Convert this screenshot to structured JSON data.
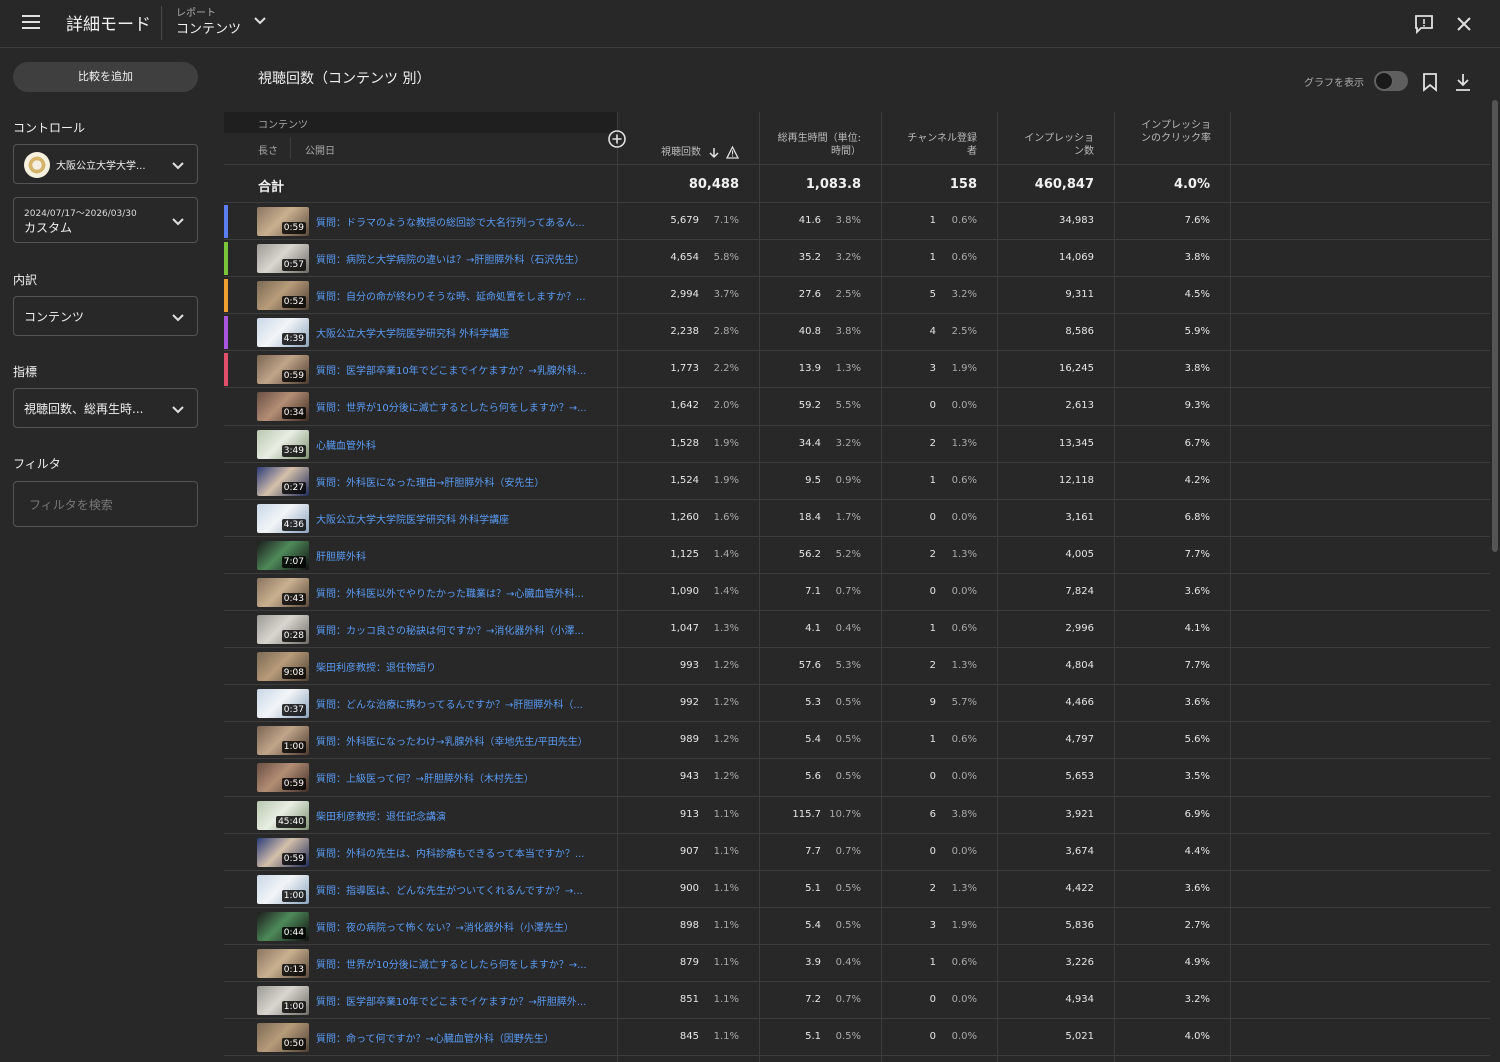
{
  "header": {
    "app_title": "詳細モード",
    "report_label": "レポート",
    "report_value": "コンテンツ"
  },
  "sidebar": {
    "compare_button": "比較を追加",
    "control_label": "コントロール",
    "channel_name": "大阪公立大学大学...",
    "date_range": "2024/07/17〜2026/03/30",
    "date_preset": "カスタム",
    "breakdown_label": "内訳",
    "breakdown_value": "コンテンツ",
    "metrics_label": "指標",
    "metrics_value": "視聴回数、総再生時...",
    "filter_label": "フィルタ",
    "filter_placeholder": "フィルタを検索"
  },
  "main": {
    "title": "視聴回数（コンテンツ 別）",
    "graph_toggle_label": "グラフを表示",
    "graph_toggle_on": false
  },
  "table": {
    "col_content": "コンテンツ",
    "col_length": "長さ",
    "col_published": "公開日",
    "col_views": "視聴回数",
    "col_watch_time": "総再生時間（単位: 時間）",
    "col_subscribers": "チャンネル登録者",
    "col_impressions": "インプレッション数",
    "col_ctr": "インプレッションのクリック率",
    "total_label": "合計",
    "totals": {
      "views": "80,488",
      "watch_time": "1,083.8",
      "subscribers": "158",
      "impressions": "460,847",
      "ctr": "4.0%"
    },
    "rows": [
      {
        "color": "#5b7ef0",
        "duration": "0:59",
        "title": "質問：ドラマのような教授の総回診で大名行列ってあるん...",
        "views": "5,679",
        "views_pct": "7.1%",
        "watch": "41.6",
        "watch_pct": "3.8%",
        "subs": "1",
        "subs_pct": "0.6%",
        "impr": "34,983",
        "ctr": "7.6%"
      },
      {
        "color": "#7cc43a",
        "duration": "0:57",
        "title": "質問：病院と大学病院の違いは？→肝胆膵外科（石沢先生）",
        "views": "4,654",
        "views_pct": "5.8%",
        "watch": "35.2",
        "watch_pct": "3.2%",
        "subs": "1",
        "subs_pct": "0.6%",
        "impr": "14,069",
        "ctr": "3.8%"
      },
      {
        "color": "#f0a030",
        "duration": "0:52",
        "title": "質問：自分の命が終わりそうな時、延命処置をしますか？...",
        "views": "2,994",
        "views_pct": "3.7%",
        "watch": "27.6",
        "watch_pct": "2.5%",
        "subs": "5",
        "subs_pct": "3.2%",
        "impr": "9,311",
        "ctr": "4.5%"
      },
      {
        "color": "#a855e0",
        "duration": "4:39",
        "title": "大阪公立大学大学院医学研究科 外科学講座",
        "views": "2,238",
        "views_pct": "2.8%",
        "watch": "40.8",
        "watch_pct": "3.8%",
        "subs": "4",
        "subs_pct": "2.5%",
        "impr": "8,586",
        "ctr": "5.9%"
      },
      {
        "color": "#e0506a",
        "duration": "0:59",
        "title": "質問：医学部卒業10年でどこまでイケますか？→乳腺外科...",
        "views": "1,773",
        "views_pct": "2.2%",
        "watch": "13.9",
        "watch_pct": "1.3%",
        "subs": "3",
        "subs_pct": "1.9%",
        "impr": "16,245",
        "ctr": "3.8%"
      },
      {
        "color": "",
        "duration": "0:34",
        "title": "質問：世界が10分後に滅亡するとしたら何をしますか？→...",
        "views": "1,642",
        "views_pct": "2.0%",
        "watch": "59.2",
        "watch_pct": "5.5%",
        "subs": "0",
        "subs_pct": "0.0%",
        "impr": "2,613",
        "ctr": "9.3%"
      },
      {
        "color": "",
        "duration": "3:49",
        "title": "心臓血管外科",
        "views": "1,528",
        "views_pct": "1.9%",
        "watch": "34.4",
        "watch_pct": "3.2%",
        "subs": "2",
        "subs_pct": "1.3%",
        "impr": "13,345",
        "ctr": "6.7%"
      },
      {
        "color": "",
        "duration": "0:27",
        "title": "質問：外科医になった理由→肝胆膵外科（安先生）",
        "views": "1,524",
        "views_pct": "1.9%",
        "watch": "9.5",
        "watch_pct": "0.9%",
        "subs": "1",
        "subs_pct": "0.6%",
        "impr": "12,118",
        "ctr": "4.2%"
      },
      {
        "color": "",
        "duration": "4:36",
        "title": "大阪公立大学大学院医学研究科 外科学講座",
        "views": "1,260",
        "views_pct": "1.6%",
        "watch": "18.4",
        "watch_pct": "1.7%",
        "subs": "0",
        "subs_pct": "0.0%",
        "impr": "3,161",
        "ctr": "6.8%"
      },
      {
        "color": "",
        "duration": "7:07",
        "title": "肝胆膵外科",
        "views": "1,125",
        "views_pct": "1.4%",
        "watch": "56.2",
        "watch_pct": "5.2%",
        "subs": "2",
        "subs_pct": "1.3%",
        "impr": "4,005",
        "ctr": "7.7%"
      },
      {
        "color": "",
        "duration": "0:43",
        "title": "質問：外科医以外でやりたかった職業は？→心臓血管外科...",
        "views": "1,090",
        "views_pct": "1.4%",
        "watch": "7.1",
        "watch_pct": "0.7%",
        "subs": "0",
        "subs_pct": "0.0%",
        "impr": "7,824",
        "ctr": "3.6%"
      },
      {
        "color": "",
        "duration": "0:28",
        "title": "質問：カッコ良さの秘訣は何ですか？→消化器外科（小澤...",
        "views": "1,047",
        "views_pct": "1.3%",
        "watch": "4.1",
        "watch_pct": "0.4%",
        "subs": "1",
        "subs_pct": "0.6%",
        "impr": "2,996",
        "ctr": "4.1%"
      },
      {
        "color": "",
        "duration": "9:08",
        "title": "柴田利彦教授：退任物語り",
        "views": "993",
        "views_pct": "1.2%",
        "watch": "57.6",
        "watch_pct": "5.3%",
        "subs": "2",
        "subs_pct": "1.3%",
        "impr": "4,804",
        "ctr": "7.7%"
      },
      {
        "color": "",
        "duration": "0:37",
        "title": "質問：どんな治療に携わってるんですか？→肝胆膵外科（...",
        "views": "992",
        "views_pct": "1.2%",
        "watch": "5.3",
        "watch_pct": "0.5%",
        "subs": "9",
        "subs_pct": "5.7%",
        "impr": "4,466",
        "ctr": "3.6%"
      },
      {
        "color": "",
        "duration": "1:00",
        "title": "質問：外科医になったわけ→乳腺外科（幸地先生/平田先生）",
        "views": "989",
        "views_pct": "1.2%",
        "watch": "5.4",
        "watch_pct": "0.5%",
        "subs": "1",
        "subs_pct": "0.6%",
        "impr": "4,797",
        "ctr": "5.6%"
      },
      {
        "color": "",
        "duration": "0:59",
        "title": "質問：上級医って何？→肝胆膵外科（木村先生）",
        "views": "943",
        "views_pct": "1.2%",
        "watch": "5.6",
        "watch_pct": "0.5%",
        "subs": "0",
        "subs_pct": "0.0%",
        "impr": "5,653",
        "ctr": "3.5%"
      },
      {
        "color": "",
        "duration": "45:40",
        "title": "柴田利彦教授：退任記念講演",
        "views": "913",
        "views_pct": "1.1%",
        "watch": "115.7",
        "watch_pct": "10.7%",
        "subs": "6",
        "subs_pct": "3.8%",
        "impr": "3,921",
        "ctr": "6.9%"
      },
      {
        "color": "",
        "duration": "0:59",
        "title": "質問：外科の先生は、内科診療もできるって本当ですか？...",
        "views": "907",
        "views_pct": "1.1%",
        "watch": "7.7",
        "watch_pct": "0.7%",
        "subs": "0",
        "subs_pct": "0.0%",
        "impr": "3,674",
        "ctr": "4.4%"
      },
      {
        "color": "",
        "duration": "1:00",
        "title": "質問：指導医は、どんな先生がついてくれるんですか？→...",
        "views": "900",
        "views_pct": "1.1%",
        "watch": "5.1",
        "watch_pct": "0.5%",
        "subs": "2",
        "subs_pct": "1.3%",
        "impr": "4,422",
        "ctr": "3.6%"
      },
      {
        "color": "",
        "duration": "0:44",
        "title": "質問：夜の病院って怖くない？→消化器外科（小澤先生）",
        "views": "898",
        "views_pct": "1.1%",
        "watch": "5.4",
        "watch_pct": "0.5%",
        "subs": "3",
        "subs_pct": "1.9%",
        "impr": "5,836",
        "ctr": "2.7%"
      },
      {
        "color": "",
        "duration": "0:13",
        "title": "質問：世界が10分後に滅亡するとしたら何をしますか？→...",
        "views": "879",
        "views_pct": "1.1%",
        "watch": "3.9",
        "watch_pct": "0.4%",
        "subs": "1",
        "subs_pct": "0.6%",
        "impr": "3,226",
        "ctr": "4.9%"
      },
      {
        "color": "",
        "duration": "1:00",
        "title": "質問：医学部卒業10年でどこまでイケますか？→肝胆膵外...",
        "views": "851",
        "views_pct": "1.1%",
        "watch": "7.2",
        "watch_pct": "0.7%",
        "subs": "0",
        "subs_pct": "0.0%",
        "impr": "4,934",
        "ctr": "3.2%"
      },
      {
        "color": "",
        "duration": "0:50",
        "title": "質問：命って何ですか？→心臓血管外科（因野先生）",
        "views": "845",
        "views_pct": "1.1%",
        "watch": "5.1",
        "watch_pct": "0.5%",
        "subs": "0",
        "subs_pct": "0.0%",
        "impr": "5,021",
        "ctr": "4.0%"
      }
    ]
  }
}
